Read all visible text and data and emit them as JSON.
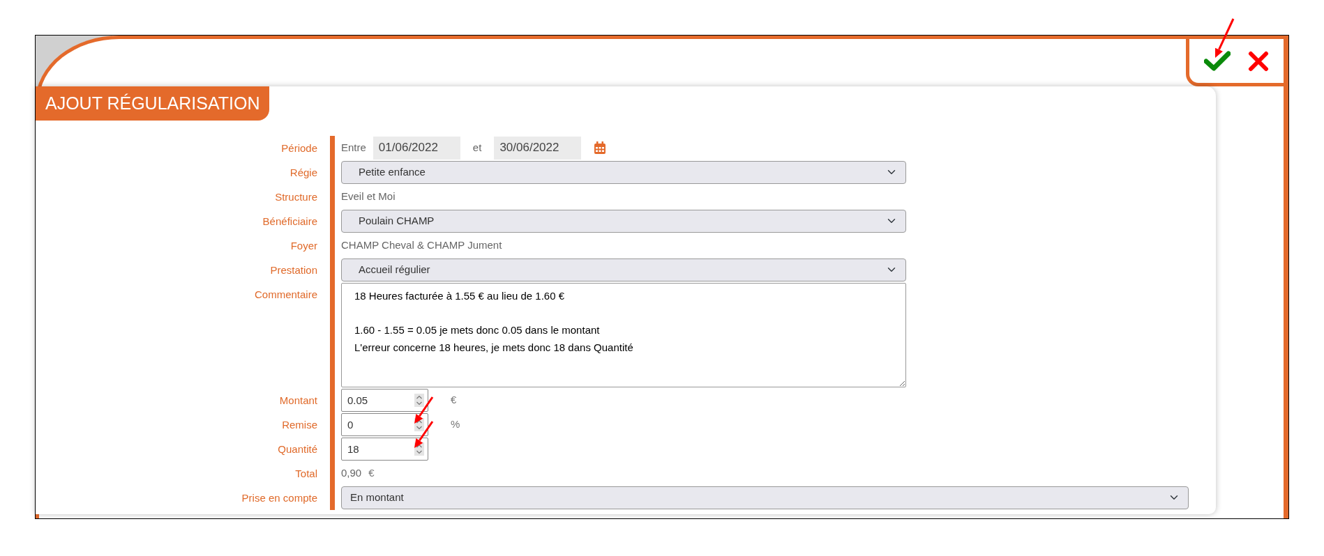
{
  "dialog": {
    "title": "AJOUT RÉGULARISATION",
    "actions": [
      {
        "kind": "confirm",
        "annotated": true
      },
      {
        "kind": "cancel",
        "annotated": false
      }
    ]
  },
  "fields": [
    {
      "kind": "period",
      "label": "Période",
      "from_label": "Entre",
      "from": "01/06/2022",
      "to_label": "et",
      "to": "30/06/2022"
    },
    {
      "kind": "select",
      "label": "Régie",
      "value": "Petite enfance"
    },
    {
      "kind": "text",
      "label": "Structure",
      "value": "Eveil et Moi"
    },
    {
      "kind": "select",
      "label": "Bénéficiaire",
      "value": "Poulain CHAMP"
    },
    {
      "kind": "text",
      "label": "Foyer",
      "value": "CHAMP Cheval & CHAMP Jument"
    },
    {
      "kind": "select",
      "label": "Prestation",
      "value": "Accueil régulier"
    },
    {
      "kind": "textarea",
      "label": "Commentaire",
      "value": "18 Heures facturée à 1.55 € au lieu de 1.60 €\n\n1.60 - 1.55 = 0.05 je mets donc 0.05 dans le montant\nL'erreur concerne 18 heures, je mets donc 18 dans Quantité"
    },
    {
      "kind": "number",
      "label": "Montant",
      "value": "0.05",
      "unit": "€",
      "annotated": false
    },
    {
      "kind": "number",
      "label": "Remise",
      "value": "0",
      "unit": "%",
      "annotated": true
    },
    {
      "kind": "number",
      "label": "Quantité",
      "value": "18",
      "annotated": true
    },
    {
      "kind": "total",
      "label": "Total",
      "value": "0,90",
      "unit": "€"
    },
    {
      "kind": "select_full",
      "label": "Prise en compte",
      "value": "En montant"
    }
  ]
}
